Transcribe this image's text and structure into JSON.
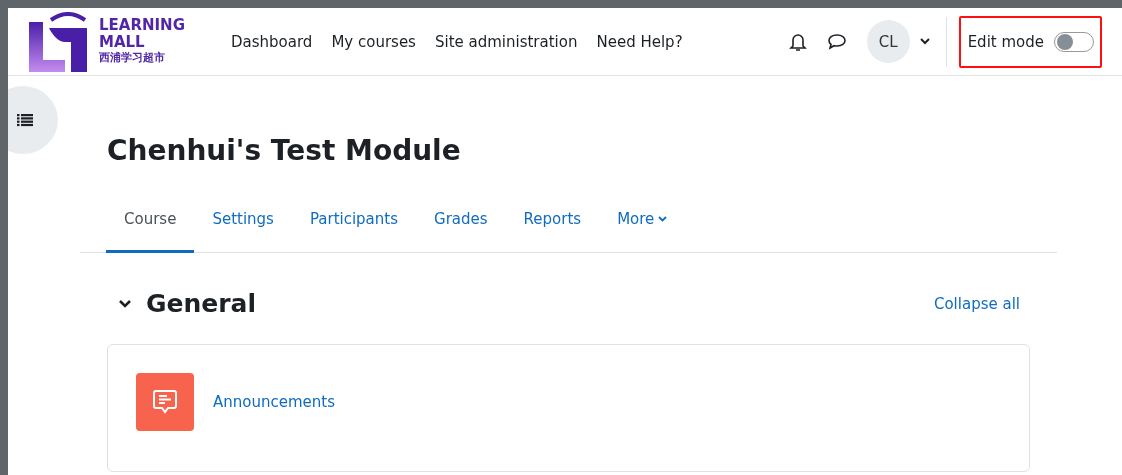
{
  "logo": {
    "line_1": "LEARNING",
    "line_2": "MALL",
    "line_3": "西浦学习超市"
  },
  "nav": [
    "Dashboard",
    "My courses",
    "Site administration",
    "Need Help?"
  ],
  "user": {
    "initials": "CL"
  },
  "edit_mode": {
    "label": "Edit mode",
    "on": false,
    "highlighted": true
  },
  "course": {
    "title": "Chenhui's Test Module"
  },
  "tabs": [
    {
      "label": "Course",
      "selected": true,
      "kind": "link"
    },
    {
      "label": "Settings",
      "selected": false,
      "kind": "link"
    },
    {
      "label": "Participants",
      "selected": false,
      "kind": "link"
    },
    {
      "label": "Grades",
      "selected": false,
      "kind": "link"
    },
    {
      "label": "Reports",
      "selected": false,
      "kind": "link"
    },
    {
      "label": "More",
      "selected": false,
      "kind": "menu"
    }
  ],
  "section": {
    "title": "General",
    "expanded": true,
    "collapse_all": "Collapse all"
  },
  "activities": [
    {
      "name": "Announcements",
      "color": "#f7634d"
    }
  ]
}
